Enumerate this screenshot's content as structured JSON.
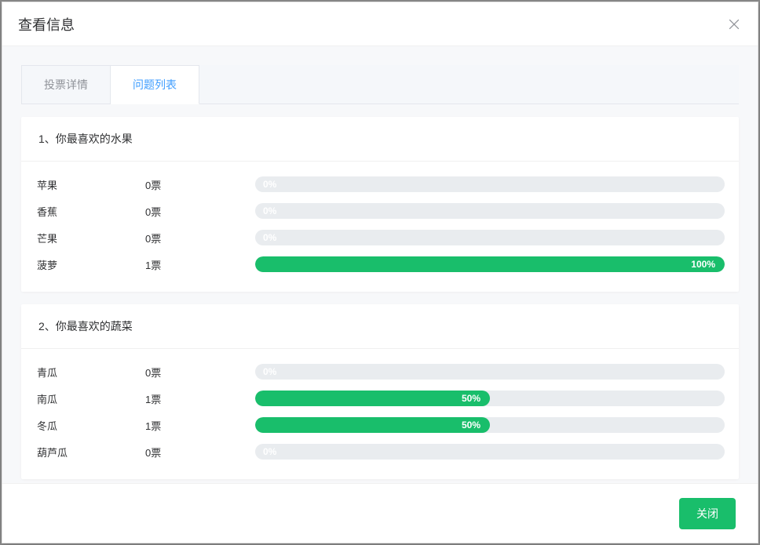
{
  "modal": {
    "title": "查看信息",
    "close_btn": "关闭"
  },
  "tabs": [
    {
      "label": "投票详情",
      "active": false
    },
    {
      "label": "问题列表",
      "active": true
    }
  ],
  "vote_unit": "票",
  "questions": [
    {
      "number": "1、",
      "title": "你最喜欢的水果",
      "options": [
        {
          "name": "苹果",
          "votes": 0,
          "percent": 0
        },
        {
          "name": "香蕉",
          "votes": 0,
          "percent": 0
        },
        {
          "name": "芒果",
          "votes": 0,
          "percent": 0
        },
        {
          "name": "菠萝",
          "votes": 1,
          "percent": 100
        }
      ]
    },
    {
      "number": "2、",
      "title": "你最喜欢的蔬菜",
      "options": [
        {
          "name": "青瓜",
          "votes": 0,
          "percent": 0
        },
        {
          "name": "南瓜",
          "votes": 1,
          "percent": 50
        },
        {
          "name": "冬瓜",
          "votes": 1,
          "percent": 50
        },
        {
          "name": "葫芦瓜",
          "votes": 0,
          "percent": 0
        }
      ]
    }
  ],
  "chart_data": [
    {
      "type": "bar",
      "title": "1、你最喜欢的水果",
      "categories": [
        "苹果",
        "香蕉",
        "芒果",
        "菠萝"
      ],
      "values": [
        0,
        0,
        0,
        100
      ],
      "votes": [
        0,
        0,
        0,
        1
      ],
      "xlabel": "",
      "ylabel": "%",
      "ylim": [
        0,
        100
      ]
    },
    {
      "type": "bar",
      "title": "2、你最喜欢的蔬菜",
      "categories": [
        "青瓜",
        "南瓜",
        "冬瓜",
        "葫芦瓜"
      ],
      "values": [
        0,
        50,
        50,
        0
      ],
      "votes": [
        0,
        1,
        1,
        0
      ],
      "xlabel": "",
      "ylabel": "%",
      "ylim": [
        0,
        100
      ]
    }
  ],
  "colors": {
    "accent_green": "#19be6b",
    "accent_blue": "#409eff",
    "track": "#e9ecef"
  }
}
